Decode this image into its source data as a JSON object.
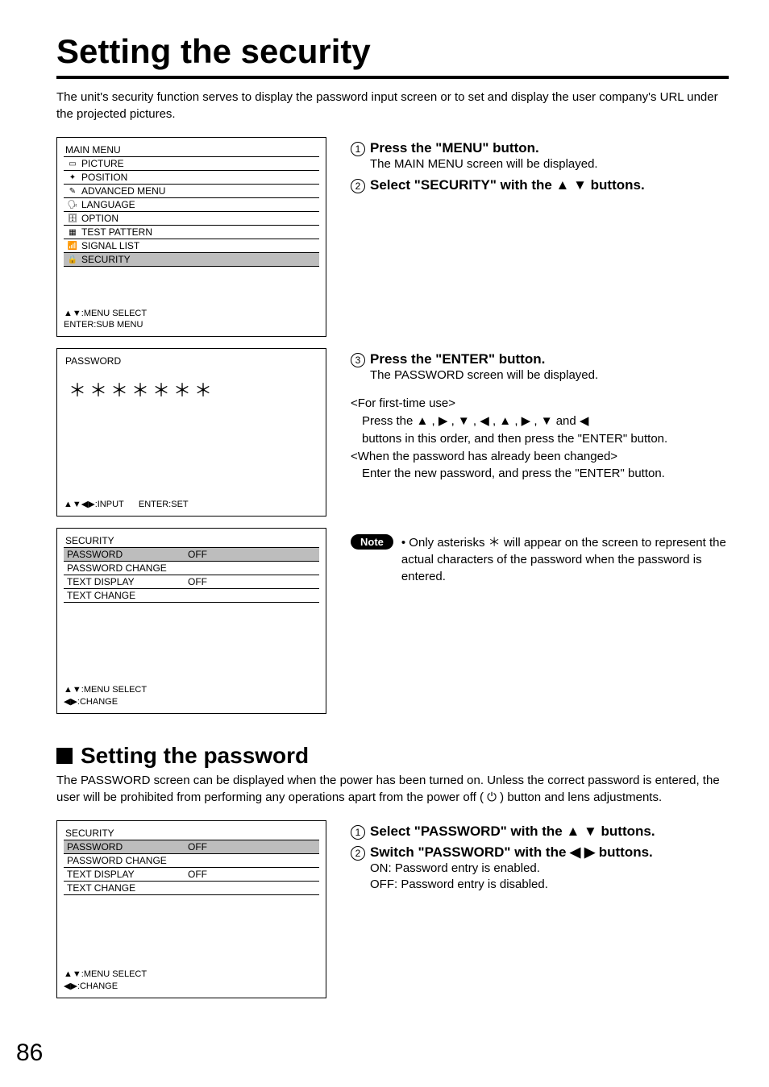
{
  "page_number": "86",
  "title": "Setting the security",
  "intro": "The unit's security function serves to display the password input screen or to set and display the user company's URL under the projected pictures.",
  "main_menu": {
    "title": "MAIN MENU",
    "items": [
      "PICTURE",
      "POSITION",
      "ADVANCED MENU",
      "LANGUAGE",
      "OPTION",
      "TEST PATTERN",
      "SIGNAL LIST",
      "SECURITY"
    ],
    "hint1": "▲▼:MENU SELECT",
    "hint2": "ENTER:SUB MENU"
  },
  "password_panel": {
    "title": "PASSWORD",
    "stars": "＊＊＊＊＊＊＊",
    "hint1": "▲▼◀▶:INPUT",
    "hint2": "ENTER:SET"
  },
  "security_panel": {
    "title": "SECURITY",
    "rows": [
      {
        "label": "PASSWORD",
        "value": "OFF",
        "selected": true
      },
      {
        "label": "PASSWORD CHANGE",
        "value": "",
        "selected": false
      },
      {
        "label": "TEXT DISPLAY",
        "value": "OFF",
        "selected": false
      },
      {
        "label": "TEXT CHANGE",
        "value": "",
        "selected": false
      }
    ],
    "hint1": "▲▼:MENU SELECT",
    "hint2": "◀▶:CHANGE"
  },
  "steps1": {
    "s1_head": "Press the \"MENU\" button.",
    "s1_body": "The MAIN MENU screen will be displayed.",
    "s2_head": "Select \"SECURITY\" with the  ▲ ▼ buttons."
  },
  "steps2": {
    "s3_head": "Press the \"ENTER\" button.",
    "s3_body": "The PASSWORD screen will be displayed.",
    "first_use_head": "<For first-time use>",
    "first_use_body1": "Press the  ▲ ,  ▶ ,  ▼ ,  ◀ ,  ▲ ,  ▶ ,  ▼  and  ◀",
    "first_use_body2": "buttons in this order, and then press the \"ENTER\" button.",
    "changed_head": "<When the password has already been changed>",
    "changed_body": "Enter the new password, and press the \"ENTER\" button."
  },
  "note": {
    "label": "Note",
    "text": "• Only asterisks ＊ will appear on the screen to represent the actual characters of the password when the password is entered."
  },
  "sub": {
    "heading": "Setting the password",
    "intro": "The PASSWORD screen can be displayed when the power has been turned on. Unless the correct password is entered, the user will be prohibited from performing any operations apart from the power off ( ⏻ ) button and lens adjustments.",
    "panel": {
      "title": "SECURITY",
      "rows": [
        {
          "label": "PASSWORD",
          "value": "OFF",
          "selected": true
        },
        {
          "label": "PASSWORD CHANGE",
          "value": "",
          "selected": false
        },
        {
          "label": "TEXT DISPLAY",
          "value": "OFF",
          "selected": false
        },
        {
          "label": "TEXT CHANGE",
          "value": "",
          "selected": false
        }
      ],
      "hint1": "▲▼:MENU SELECT",
      "hint2": "◀▶:CHANGE"
    },
    "steps": {
      "s1": "Select \"PASSWORD\" with the  ▲ ▼ buttons.",
      "s2_head": "Switch \"PASSWORD\" with the  ◀  ▶ buttons.",
      "s2_b1": "ON: Password entry is enabled.",
      "s2_b2": "OFF: Password entry is disabled."
    }
  }
}
